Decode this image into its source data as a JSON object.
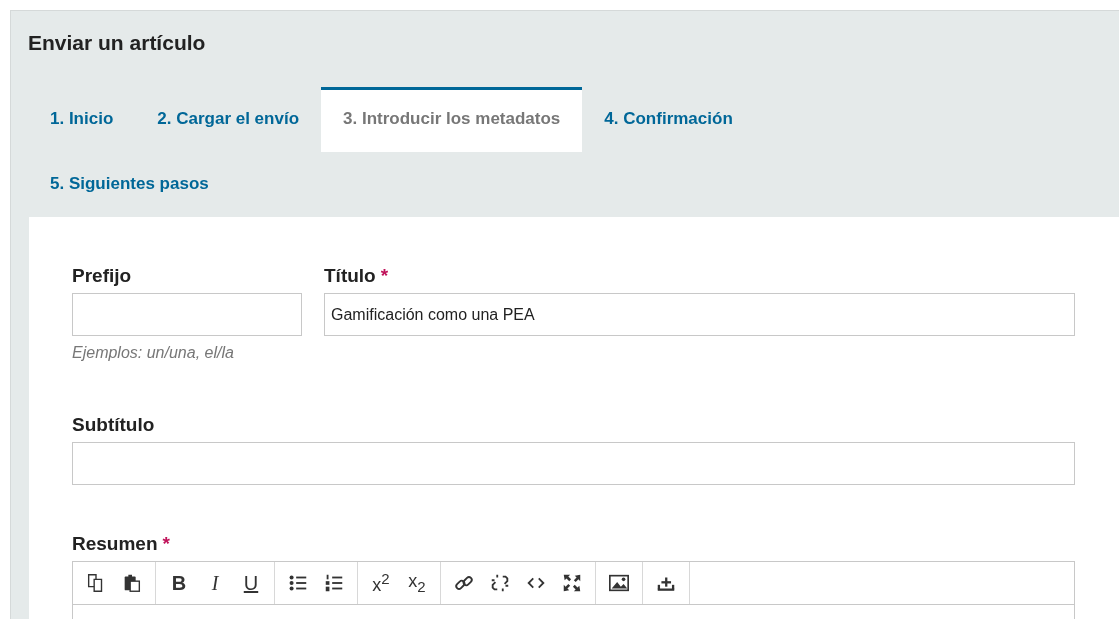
{
  "page_title": "Enviar un artículo",
  "tabs": [
    {
      "label": "1. Inicio",
      "selected": false
    },
    {
      "label": "2. Cargar el envío",
      "selected": false
    },
    {
      "label": "3. Introducir los metadatos",
      "selected": true
    },
    {
      "label": "4. Confirmación",
      "selected": false
    },
    {
      "label": "5. Siguientes pasos",
      "selected": false
    }
  ],
  "prefix": {
    "label": "Prefijo",
    "hint": "Ejemplos: un/una, el/la"
  },
  "title": {
    "label": "Título",
    "required_mark": "*",
    "value": "Gamificación como una PEA"
  },
  "subtitle": {
    "label": "Subtítulo"
  },
  "abstract": {
    "label": "Resumen",
    "required_mark": "*",
    "toolbar": [
      [
        {
          "kind": "copy"
        },
        {
          "kind": "paste"
        }
      ],
      [
        {
          "kind": "bold",
          "label": "B"
        },
        {
          "kind": "italic",
          "label": "I"
        },
        {
          "kind": "underline",
          "label": "U"
        }
      ],
      [
        {
          "kind": "bullets"
        },
        {
          "kind": "numbers"
        }
      ],
      [
        {
          "kind": "superscript",
          "label": "x$^{2}$"
        },
        {
          "kind": "subscript",
          "label": "x$_{2}$"
        }
      ],
      [
        {
          "kind": "link"
        },
        {
          "kind": "unlink"
        },
        {
          "kind": "code"
        },
        {
          "kind": "fullscreen"
        }
      ],
      [
        {
          "kind": "image"
        }
      ],
      [
        {
          "kind": "upload"
        }
      ]
    ]
  }
}
